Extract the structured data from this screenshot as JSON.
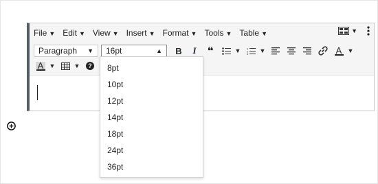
{
  "menubar": {
    "items": [
      "File",
      "Edit",
      "View",
      "Insert",
      "Format",
      "Tools",
      "Table"
    ],
    "blocks_icon": "table-grid-icon",
    "more_icon": "kebab-icon"
  },
  "toolbar": {
    "format_select": "Paragraph",
    "font_size_select": "16pt",
    "buttons_row1": [
      "bold-icon",
      "italic-icon",
      "blockquote-icon",
      "bullet-list-icon",
      "numbered-list-icon",
      "align-left-icon",
      "align-center-icon",
      "align-right-icon",
      "link-icon",
      "text-color-icon"
    ],
    "buttons_row2": [
      "background-color-icon",
      "table-icon",
      "help-icon"
    ],
    "bold_glyph": "B",
    "italic_glyph": "I",
    "quote_glyph": "❝",
    "help_glyph": "?",
    "text_color_glyph": "A",
    "bg_color_glyph": "A"
  },
  "font_size_dropdown": {
    "options": [
      "8pt",
      "10pt",
      "12pt",
      "14pt",
      "18pt",
      "24pt",
      "36pt"
    ]
  },
  "add_block_icon": "plus-circle-icon"
}
